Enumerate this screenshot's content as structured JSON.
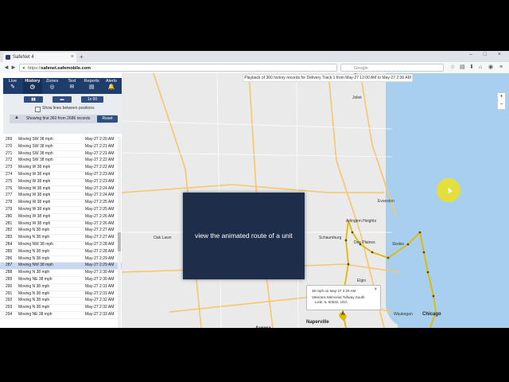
{
  "browser": {
    "tab_title": "SafeNet 4",
    "tab_close": "×",
    "new_tab": "+",
    "window_controls": "–  □  ×",
    "url_prefix": "https://",
    "url_domain": "safenet.safemobile.com",
    "search_placeholder": "Google",
    "nav_back": "◄",
    "nav_forward": "►"
  },
  "sidebar": {
    "tabs": [
      {
        "label": "Live",
        "icon": "pencil-icon",
        "glyph": "✎"
      },
      {
        "label": "History",
        "icon": "clock-icon",
        "glyph": "◷"
      },
      {
        "label": "Zones",
        "icon": "zone-icon",
        "glyph": "◎"
      },
      {
        "label": "Text",
        "icon": "envelope-icon",
        "glyph": "✉"
      },
      {
        "label": "Reports",
        "icon": "report-icon",
        "glyph": "▤"
      },
      {
        "label": "Alerts",
        "icon": "bell-icon",
        "glyph": "🔔"
      }
    ],
    "speed_button": "1x 00",
    "show_lines_label": "Show lines between positions",
    "showing_text": "Showing first 360 from 2686 records",
    "reset_label": "Reset"
  },
  "history_rows": [
    {
      "num": "269",
      "status": "Moving SW 38 mph",
      "time": "May-27 2:20 AM"
    },
    {
      "num": "270",
      "status": "Moving SW 38 mph",
      "time": "May-27 2:21 AM"
    },
    {
      "num": "271",
      "status": "Moving SW 38 mph",
      "time": "May-27 2:21 AM"
    },
    {
      "num": "272",
      "status": "Moving SW 38 mph",
      "time": "May-27 2:22 AM"
    },
    {
      "num": "273",
      "status": "Moving W 38 mph",
      "time": "May-27 2:22 AM"
    },
    {
      "num": "274",
      "status": "Moving W 38 mph",
      "time": "May-27 2:23 AM"
    },
    {
      "num": "275",
      "status": "Moving W 38 mph",
      "time": "May-27 2:23 AM"
    },
    {
      "num": "276",
      "status": "Moving W 38 mph",
      "time": "May-27 2:24 AM"
    },
    {
      "num": "277",
      "status": "Moving W 38 mph",
      "time": "May-27 2:24 AM"
    },
    {
      "num": "278",
      "status": "Moving W 38 mph",
      "time": "May-27 2:25 AM"
    },
    {
      "num": "279",
      "status": "Moving W 38 mph",
      "time": "May-27 2:25 AM"
    },
    {
      "num": "280",
      "status": "Moving W 38 mph",
      "time": "May-27 2:26 AM"
    },
    {
      "num": "281",
      "status": "Moving W 38 mph",
      "time": "May-27 2:26 AM"
    },
    {
      "num": "282",
      "status": "Moving N 38 mph",
      "time": "May-27 2:27 AM"
    },
    {
      "num": "283",
      "status": "Moving N 38 mph",
      "time": "May-27 2:27 AM"
    },
    {
      "num": "284",
      "status": "Moving NW 38 mph",
      "time": "May-27 2:28 AM"
    },
    {
      "num": "285",
      "status": "Moving N 38 mph",
      "time": "May-27 2:28 AM"
    },
    {
      "num": "286",
      "status": "Moving N 38 mph",
      "time": "May-27 2:29 AM"
    },
    {
      "num": "287",
      "status": "Moving NW 38 mph",
      "time": "May-27 2:29 AM",
      "selected": true
    },
    {
      "num": "288",
      "status": "Moving N 38 mph",
      "time": "May-27 2:30 AM"
    },
    {
      "num": "289",
      "status": "Moving NE 38 mph",
      "time": "May-27 2:30 AM"
    },
    {
      "num": "290",
      "status": "Moving N 38 mph",
      "time": "May-27 2:31 AM"
    },
    {
      "num": "291",
      "status": "Moving N 38 mph",
      "time": "May-27 2:31 AM"
    },
    {
      "num": "292",
      "status": "Moving N 38 mph",
      "time": "May-27 2:32 AM"
    },
    {
      "num": "293",
      "status": "Moving N 38 mph",
      "time": "May-27 2:32 AM"
    },
    {
      "num": "294",
      "status": "Moving NE 38 mph",
      "time": "May-27 2:33 AM"
    }
  ],
  "map": {
    "playback_text": "Playback of 360 history records for Delivery Track 1 from May-27 12:00 AM to May-27 2:36 AM",
    "zoom_in": "+",
    "zoom_out": "−",
    "labels": [
      {
        "text": "Chicago",
        "big": true
      },
      {
        "text": "Naperville",
        "big": true
      },
      {
        "text": "Aurora",
        "big": true
      },
      {
        "text": "Schaumburg"
      },
      {
        "text": "Des Plaines"
      },
      {
        "text": "Arlington Heights"
      },
      {
        "text": "Skokie"
      },
      {
        "text": "Evanston"
      },
      {
        "text": "Joliet"
      },
      {
        "text": "Oak Lawn"
      },
      {
        "text": "Waukegan"
      },
      {
        "text": "Elgin"
      },
      {
        "text": "Cicero"
      }
    ],
    "popup_line1": "38 mph on May-27 2:29 AM",
    "popup_line2": "Veterans Memorial Tollway South",
    "popup_line3": "Lisle, IL 60532, USA",
    "popup_close": "×",
    "route_color": "#e0b800",
    "marker_label": "A"
  },
  "overlay": {
    "caption": "view the animated route of a unit"
  },
  "colors": {
    "nav_bg": "#1f3d6b",
    "button_bg": "#2f4f83",
    "lake": "#a8d0ee",
    "highlight": "#f0e21c"
  }
}
